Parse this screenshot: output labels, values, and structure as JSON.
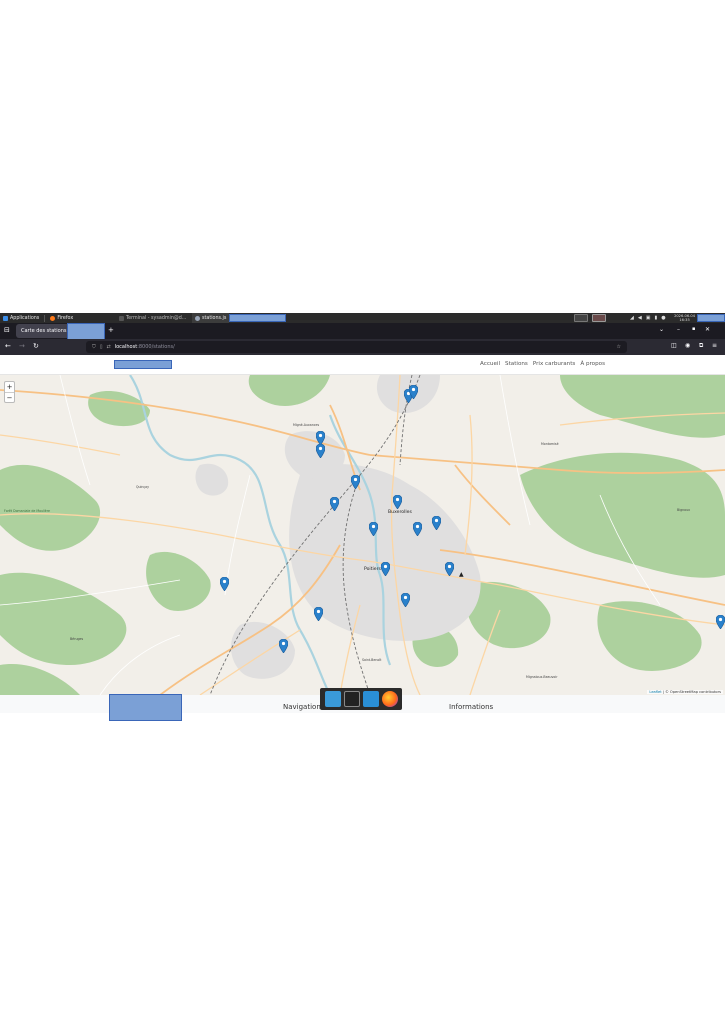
{
  "panel": {
    "applications_label": "Applications",
    "firefox_label": "Firefox",
    "task_terminal": "Terminal - sysadmin@d...",
    "task_stations": "stations.js",
    "clock_date": "2026-06-04",
    "clock_time": "16:35"
  },
  "browser": {
    "tab_title": "Carte des stations",
    "new_tab_symbol": "+",
    "url_host": "localhost",
    "url_path": ":8000/stations/"
  },
  "site": {
    "nav": [
      "Accueil",
      "Stations",
      "Prix carburants",
      "À propos"
    ]
  },
  "map": {
    "zoom_in": "+",
    "zoom_out": "−",
    "attribution_leaflet": "Leaflet",
    "attribution_osm": "| © OpenStreetMap contributors",
    "labels": [
      {
        "text": "Migné-Auxances",
        "cls": "maplabel"
      },
      {
        "text": "Buxerolles",
        "cls": "maplabel big"
      },
      {
        "text": "Poitiers",
        "cls": "maplabel big"
      },
      {
        "text": "Quinçay",
        "cls": "maplabel"
      },
      {
        "text": "Béruges",
        "cls": "maplabel"
      },
      {
        "text": "Mignaloux-Beauvoir",
        "cls": "maplabel"
      },
      {
        "text": "Bignoux",
        "cls": "maplabel"
      },
      {
        "text": "Saint-Benoît",
        "cls": "maplabel"
      },
      {
        "text": "Montamisé",
        "cls": "maplabel"
      },
      {
        "text": "Forêt Domaniale de Moulière",
        "cls": "maplabel green"
      }
    ],
    "marker_count": 21
  },
  "footer": {
    "navigation_heading": "Navigation",
    "informations_heading": "Informations"
  },
  "colors": {
    "marker": "#2a81cb",
    "forest": "#add19e",
    "urban": "#e0dfdf",
    "road_major": "#f7c184",
    "road_primary": "#fcd6a4",
    "rail": "#707070",
    "water": "#aad3df",
    "redaction": "#7ba0d6"
  }
}
